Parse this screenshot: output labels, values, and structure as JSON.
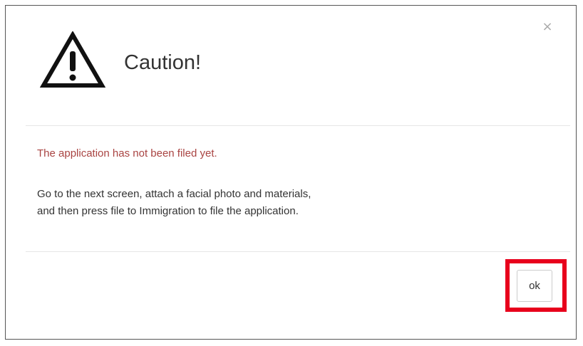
{
  "dialog": {
    "title": "Caution!",
    "close_glyph": "×",
    "icon": "warning-triangle-icon",
    "warning_color": "#a94442",
    "warning_message": "The application has not been filed yet.",
    "instruction_lines": [
      "Go to the next screen, attach a facial photo and materials,",
      "and then press file to Immigration to file the application."
    ],
    "ok_label": "ok",
    "highlight_color": "#e8001c"
  }
}
